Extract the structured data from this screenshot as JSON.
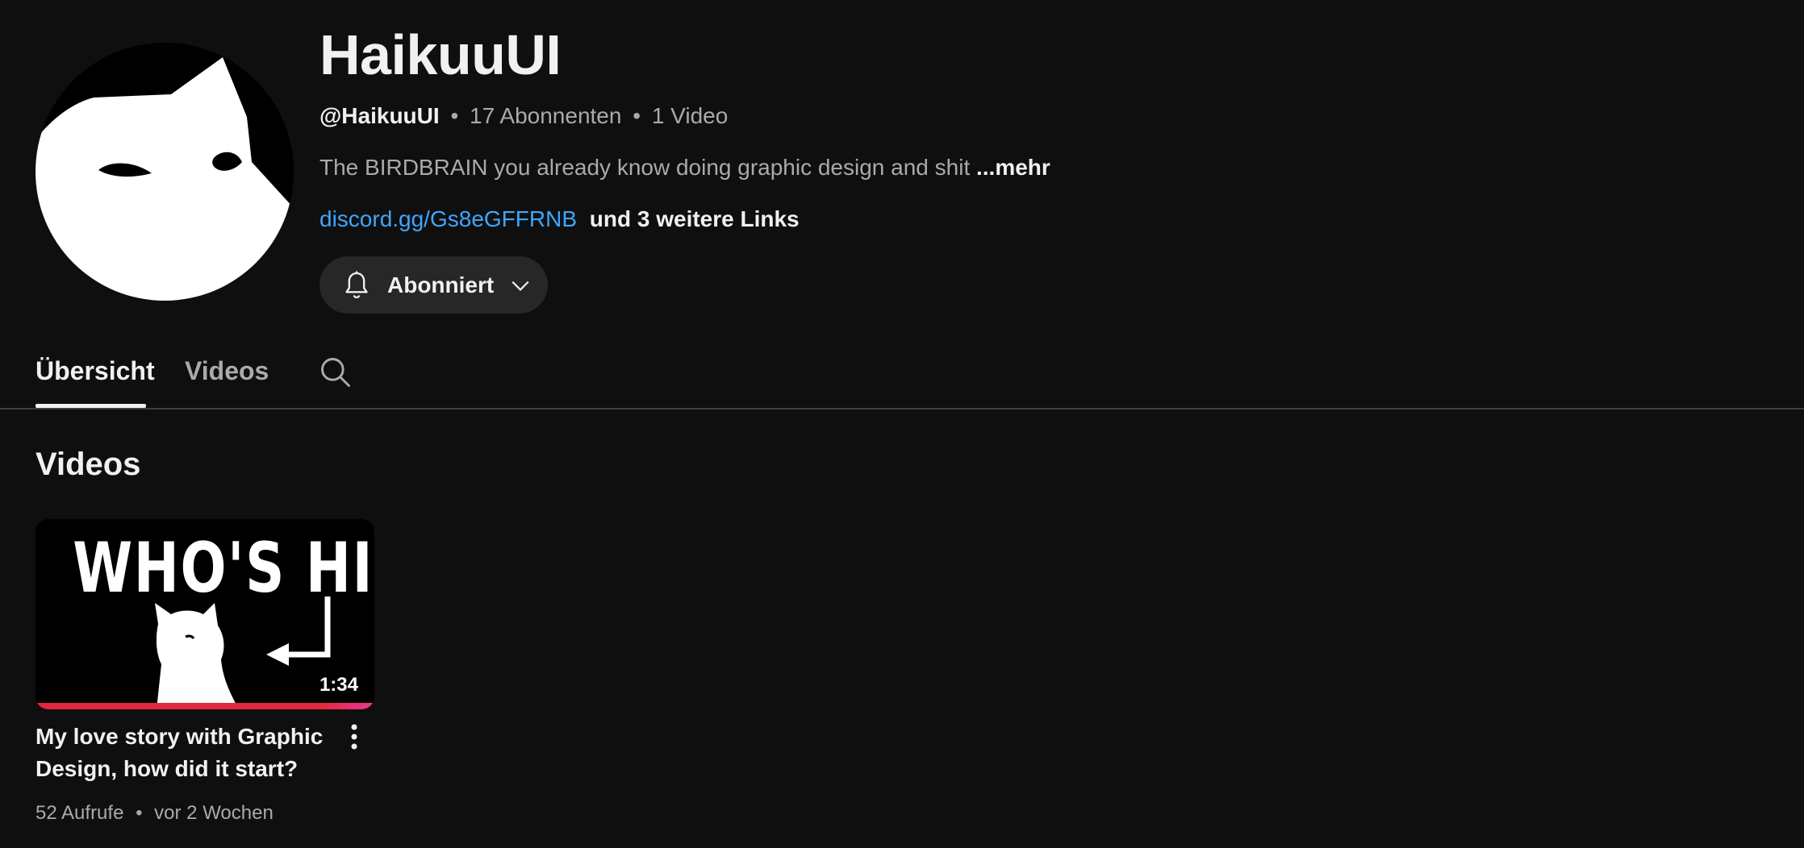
{
  "channel": {
    "name": "HaikuuUI",
    "handle": "@HaikuuUI",
    "separator": "•",
    "subscribers": "17 Abonnenten",
    "video_count": "1 Video",
    "description": "The BIRDBRAIN you already know doing graphic design and shit",
    "description_more": "...mehr",
    "link": "discord.gg/Gs8eGFFRNB",
    "more_links": "und 3 weitere Links",
    "avatar_icon": "cat-avatar"
  },
  "subscribe_button": {
    "label": "Abonniert",
    "icon": "bell-icon",
    "dropdown_icon": "chevron-down-icon"
  },
  "tabs": [
    {
      "label": "Übersicht",
      "active": true
    },
    {
      "label": "Videos",
      "active": false
    }
  ],
  "tab_search_icon": "search-icon",
  "section": {
    "title": "Videos"
  },
  "videos": [
    {
      "thumbnail_text": "WHO'S HIM",
      "duration": "1:34",
      "watched_fraction": 1.0,
      "title": "My love story with Graphic Design, how did it start?",
      "views": "52 Aufrufe",
      "age": "vor 2 Wochen",
      "menu_icon": "more-vert-icon"
    }
  ],
  "colors": {
    "background": "#0f0f0f",
    "link": "#3ea6ff",
    "progress": "#e3283e",
    "button_bg": "#272727",
    "secondary_text": "#aaaaaa"
  }
}
